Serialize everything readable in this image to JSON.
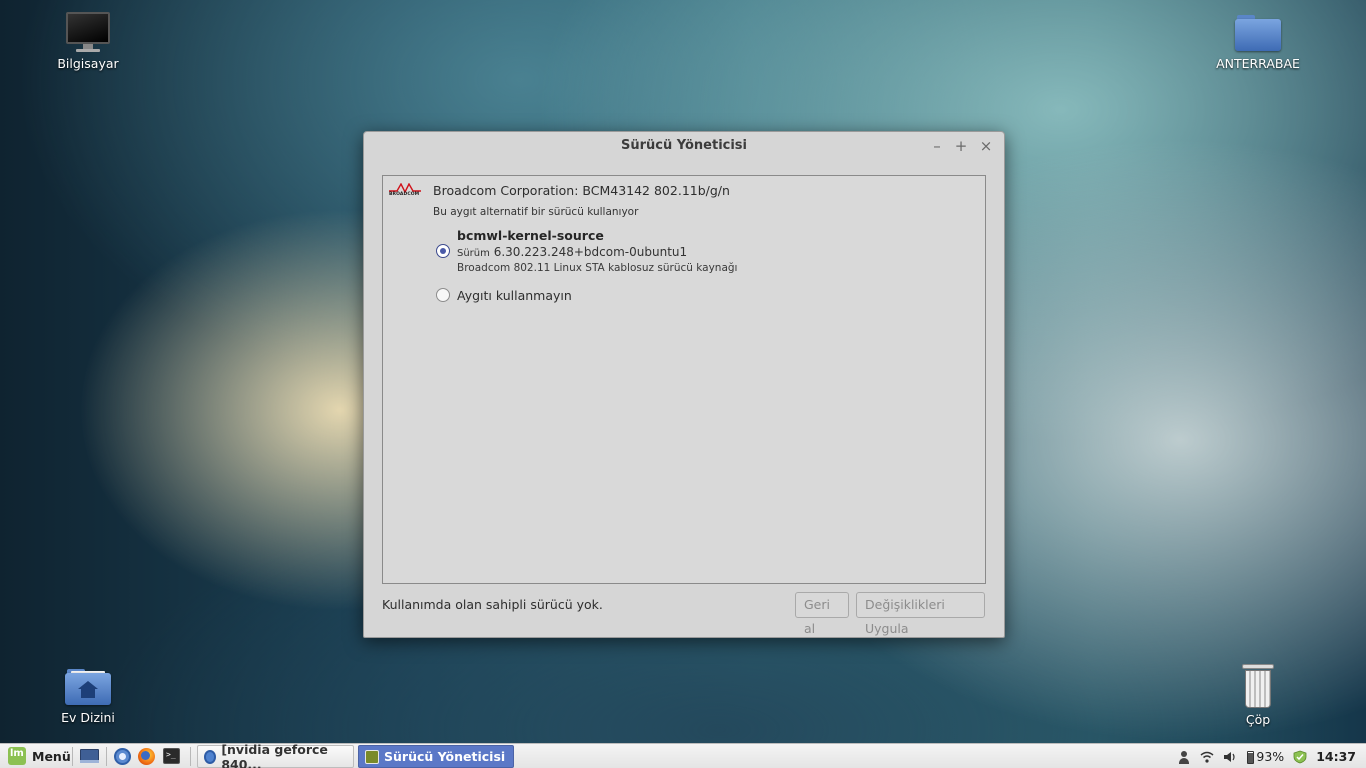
{
  "desktop": {
    "icons": [
      {
        "label": "Bilgisayar"
      },
      {
        "label": "ANTERRABAE"
      },
      {
        "label": "Ev Dizini"
      },
      {
        "label": "Çöp"
      }
    ]
  },
  "dialog": {
    "title": "Sürücü Yöneticisi",
    "controls": {
      "minimize": "–",
      "maximize": "+",
      "close": "×"
    },
    "device": {
      "logo_text": "BROADCOM",
      "name": "Broadcom Corporation: BCM43142 802.11b/g/n",
      "status": "Bu aygıt alternatif bir sürücü kullanıyor"
    },
    "drivers": [
      {
        "name": "bcmwl-kernel-source",
        "version_prefix": "Sürüm",
        "version": "6.30.223.248+bdcom-0ubuntu1",
        "description": "Broadcom 802.11 Linux STA kablosuz sürücü kaynağı",
        "selected": true
      }
    ],
    "option_none": {
      "label": "Aygıtı kullanmayın",
      "selected": false
    },
    "status_text": "Kullanımda olan sahipli sürücü yok.",
    "buttons": {
      "revert": "Geri al",
      "apply": "Değişiklikleri Uygula"
    }
  },
  "taskbar": {
    "menu_label": "Menü",
    "tasks": [
      {
        "label": "[nvidia geforce 840...",
        "active": false
      },
      {
        "label": "Sürücü Yöneticisi",
        "active": true
      }
    ],
    "tray": {
      "battery": "93%",
      "clock": "14:37"
    }
  },
  "colors": {
    "accent": "#5b78c7",
    "radio_selected": "#4a5aa8",
    "mint": "#8cc152"
  }
}
